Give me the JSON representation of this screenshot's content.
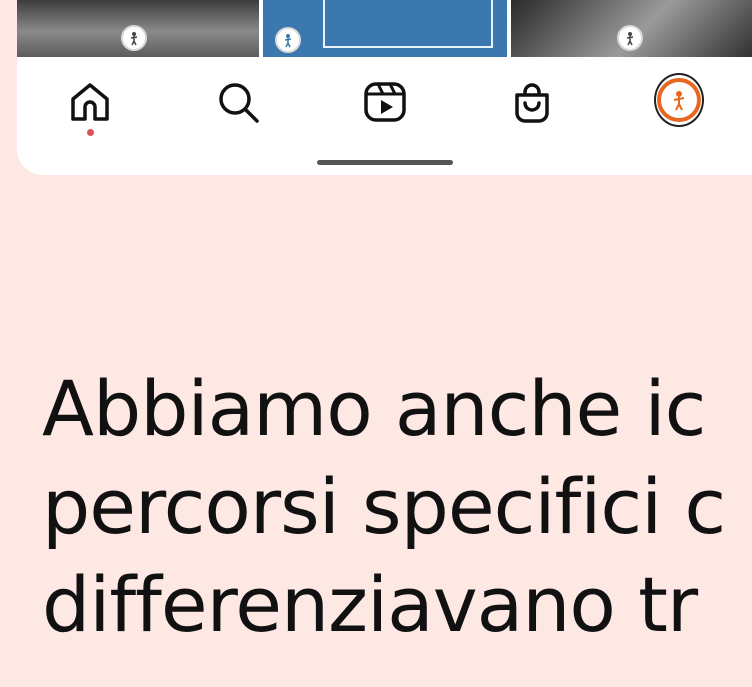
{
  "thumbnails": [
    {
      "icon": "club-logo-icon",
      "style": "grayscale-photo"
    },
    {
      "icon": "club-logo-icon",
      "style": "blue-graphic"
    },
    {
      "icon": "club-logo-icon",
      "style": "grayscale-photo"
    }
  ],
  "bottom_nav": {
    "items": [
      {
        "name": "home",
        "icon": "home-icon",
        "active": true
      },
      {
        "name": "search",
        "icon": "search-icon"
      },
      {
        "name": "reels",
        "icon": "reels-icon"
      },
      {
        "name": "shop",
        "icon": "shopping-bag-icon"
      },
      {
        "name": "profile",
        "icon": "avatar"
      }
    ],
    "notification_dot_color": "#e0505a",
    "profile_ring_color": "#e8671f"
  },
  "caption": {
    "line1": "Abbiamo anche ic",
    "line2": "percorsi specifici c",
    "line3": "differenziavano tr"
  },
  "colors": {
    "background": "#fde8e4",
    "card": "#ffffff",
    "text": "#111111"
  }
}
